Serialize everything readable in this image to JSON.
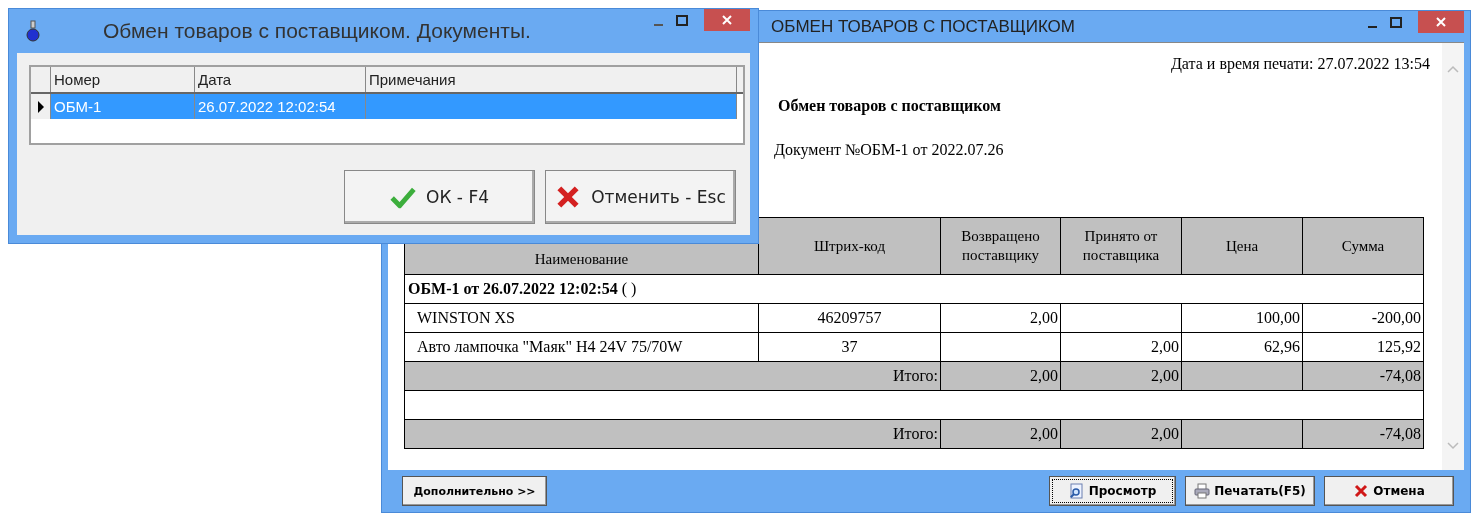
{
  "report_window": {
    "title": "ОБМЕН ТОВАРОВ С ПОСТАВЩИКОМ",
    "print_time": "Дата и время печати: 27.07.2022 13:54",
    "heading": "Обмен товаров с поставщиком",
    "document": "Документ №ОБМ-1 от 2022.07.26",
    "table": {
      "columns": [
        "Наименование",
        "Штрих-код",
        "Возвращено поставщику",
        "Принято от поставщика",
        "Цена",
        "Сумма"
      ],
      "rows": [
        {
          "kind": "group",
          "text": "**ОБМ-1 от 26.07.2022 12:02:54** ( )"
        },
        {
          "kind": "item",
          "cells": [
            "WINSTON XS",
            "46209757",
            "2,00",
            "",
            "100,00",
            "-200,00"
          ]
        },
        {
          "kind": "item",
          "cells": [
            "Авто лампочка \"Маяк\" H4 24V 75/70W",
            "37",
            "",
            "2,00",
            "62,96",
            "125,92"
          ]
        },
        {
          "kind": "total",
          "label": "Итого:",
          "cells": [
            "2,00",
            "2,00",
            "",
            "-74,08"
          ]
        },
        {
          "kind": "blank"
        },
        {
          "kind": "total",
          "label": "Итого:",
          "cells": [
            "2,00",
            "2,00",
            "",
            "-74,08"
          ]
        }
      ]
    },
    "buttons": [
      {
        "kind": "more",
        "label": "Дополнительно >>"
      },
      {
        "kind": "preview",
        "label": "Просмотр"
      },
      {
        "kind": "print",
        "label": "Печатать(F5)"
      },
      {
        "kind": "cancel",
        "label": "Отмена"
      }
    ]
  },
  "dialog": {
    "title": "Обмен товаров с поставщиком. Документы.",
    "columns": [
      "Номер",
      "Дата",
      "Примечания"
    ],
    "rows": [
      {
        "cells": [
          "ОБМ-1",
          "26.07.2022 12:02:54",
          ""
        ],
        "selected": true
      }
    ],
    "buttons": [
      {
        "kind": "ok",
        "label": "ОК - F4"
      },
      {
        "kind": "cancel",
        "label": "Отменить - Esc"
      }
    ]
  }
}
